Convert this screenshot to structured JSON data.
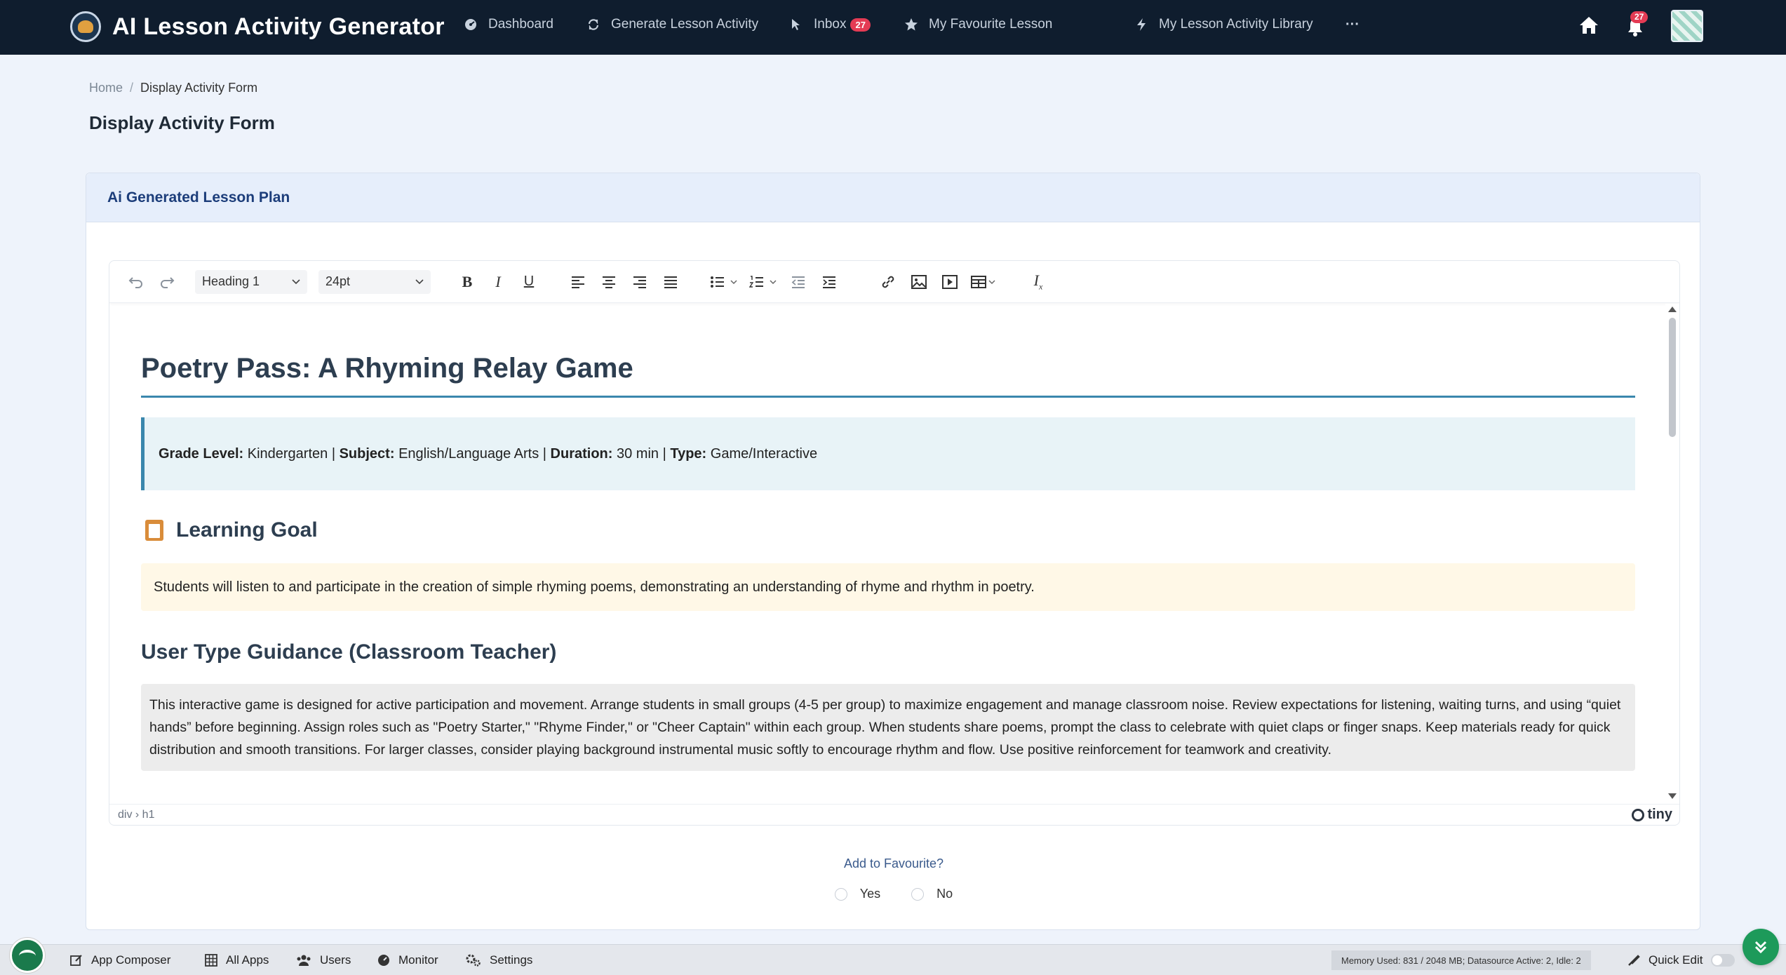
{
  "app": {
    "title": "AI Lesson Activity Generator"
  },
  "nav": {
    "items": [
      {
        "label": "Dashboard",
        "icon": "dashboard-icon"
      },
      {
        "label": "Generate Lesson Activity",
        "icon": "refresh-icon"
      },
      {
        "label": "Inbox",
        "icon": "pointer-icon",
        "badge": "27"
      },
      {
        "label": "My Favourite Lesson",
        "icon": "star-icon"
      },
      {
        "label": "My Lesson Activity Library",
        "icon": "bolt-icon"
      }
    ],
    "more": "···",
    "notification_count": "27"
  },
  "breadcrumb": {
    "home": "Home",
    "separator": "/",
    "current": "Display Activity Form"
  },
  "page": {
    "title": "Display Activity Form"
  },
  "card": {
    "title": "Ai Generated Lesson Plan"
  },
  "toolbar": {
    "block_format": "Heading 1",
    "font_size": "24pt"
  },
  "document": {
    "heading": "Poetry Pass: A Rhyming Relay Game",
    "meta": {
      "grade_label": "Grade Level:",
      "grade_value": "Kindergarten",
      "subject_label": "Subject:",
      "subject_value": "English/Language Arts",
      "duration_label": "Duration:",
      "duration_value": "30 min",
      "type_label": "Type:",
      "type_value": "Game/Interactive",
      "divider": "|"
    },
    "goal_heading": "Learning Goal",
    "goal_text": "Students will listen to and participate in the creation of simple rhyming poems, demonstrating an understanding of rhyme and rhythm in poetry.",
    "guidance_heading": "User Type Guidance (Classroom Teacher)",
    "guidance_text": "This interactive game is designed for active participation and movement. Arrange students in small groups (4-5 per group) to maximize engagement and manage classroom noise. Review expectations for listening, waiting turns, and using “quiet hands” before beginning. Assign roles such as \"Poetry Starter,\" \"Rhyme Finder,\" or \"Cheer Captain\" within each group. When students share poems, prompt the class to celebrate with quiet claps or finger snaps. Keep materials ready for quick distribution and smooth transitions. For larger classes, consider playing background instrumental music softly to encourage rhythm and flow. Use positive reinforcement for teamwork and creativity."
  },
  "editor_status": {
    "path": "div › h1",
    "brand": "tiny"
  },
  "favourite": {
    "label": "Add to Favourite?",
    "yes": "Yes",
    "no": "No"
  },
  "bottombar": {
    "items": [
      "App Composer",
      "All Apps",
      "Users",
      "Monitor",
      "Settings"
    ],
    "memory": "Memory Used: 831 / 2048 MB; Datasource Active: 2, Idle: 2",
    "quick_edit": "Quick Edit"
  },
  "colors": {
    "navbar": "#0f1d2e",
    "accent": "#3a87ad",
    "badge": "#e43b54",
    "fab": "#1d9a5a"
  }
}
